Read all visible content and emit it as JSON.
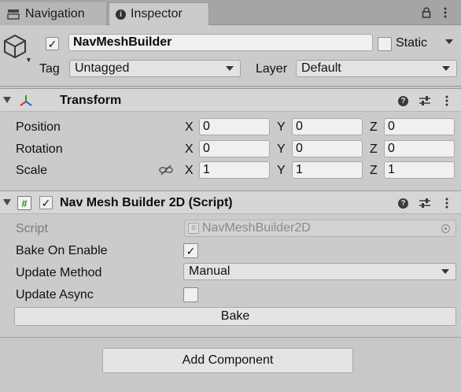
{
  "tabs": {
    "navigation_label": "Navigation",
    "inspector_label": "Inspector"
  },
  "gameobject": {
    "name": "NavMeshBuilder",
    "active": true,
    "static_label": "Static",
    "static": false,
    "tag_label": "Tag",
    "tag_value": "Untagged",
    "layer_label": "Layer",
    "layer_value": "Default"
  },
  "transform": {
    "title": "Transform",
    "position_label": "Position",
    "rotation_label": "Rotation",
    "scale_label": "Scale",
    "axis_x": "X",
    "axis_y": "Y",
    "axis_z": "Z",
    "position": {
      "x": "0",
      "y": "0",
      "z": "0"
    },
    "rotation": {
      "x": "0",
      "y": "0",
      "z": "0"
    },
    "scale": {
      "x": "1",
      "y": "1",
      "z": "1"
    }
  },
  "script_component": {
    "title": "Nav Mesh Builder 2D (Script)",
    "enabled": true,
    "script_label": "Script",
    "script_value": "NavMeshBuilder2D",
    "bake_on_enable_label": "Bake On Enable",
    "bake_on_enable": true,
    "update_method_label": "Update Method",
    "update_method_value": "Manual",
    "update_async_label": "Update Async",
    "update_async": false,
    "bake_button_label": "Bake"
  },
  "add_component_label": "Add Component",
  "icons": {
    "help": "help-icon",
    "presets": "presets-icon",
    "menu": "kebab-menu-icon",
    "lock": "lock-icon",
    "link": "link-icon"
  }
}
